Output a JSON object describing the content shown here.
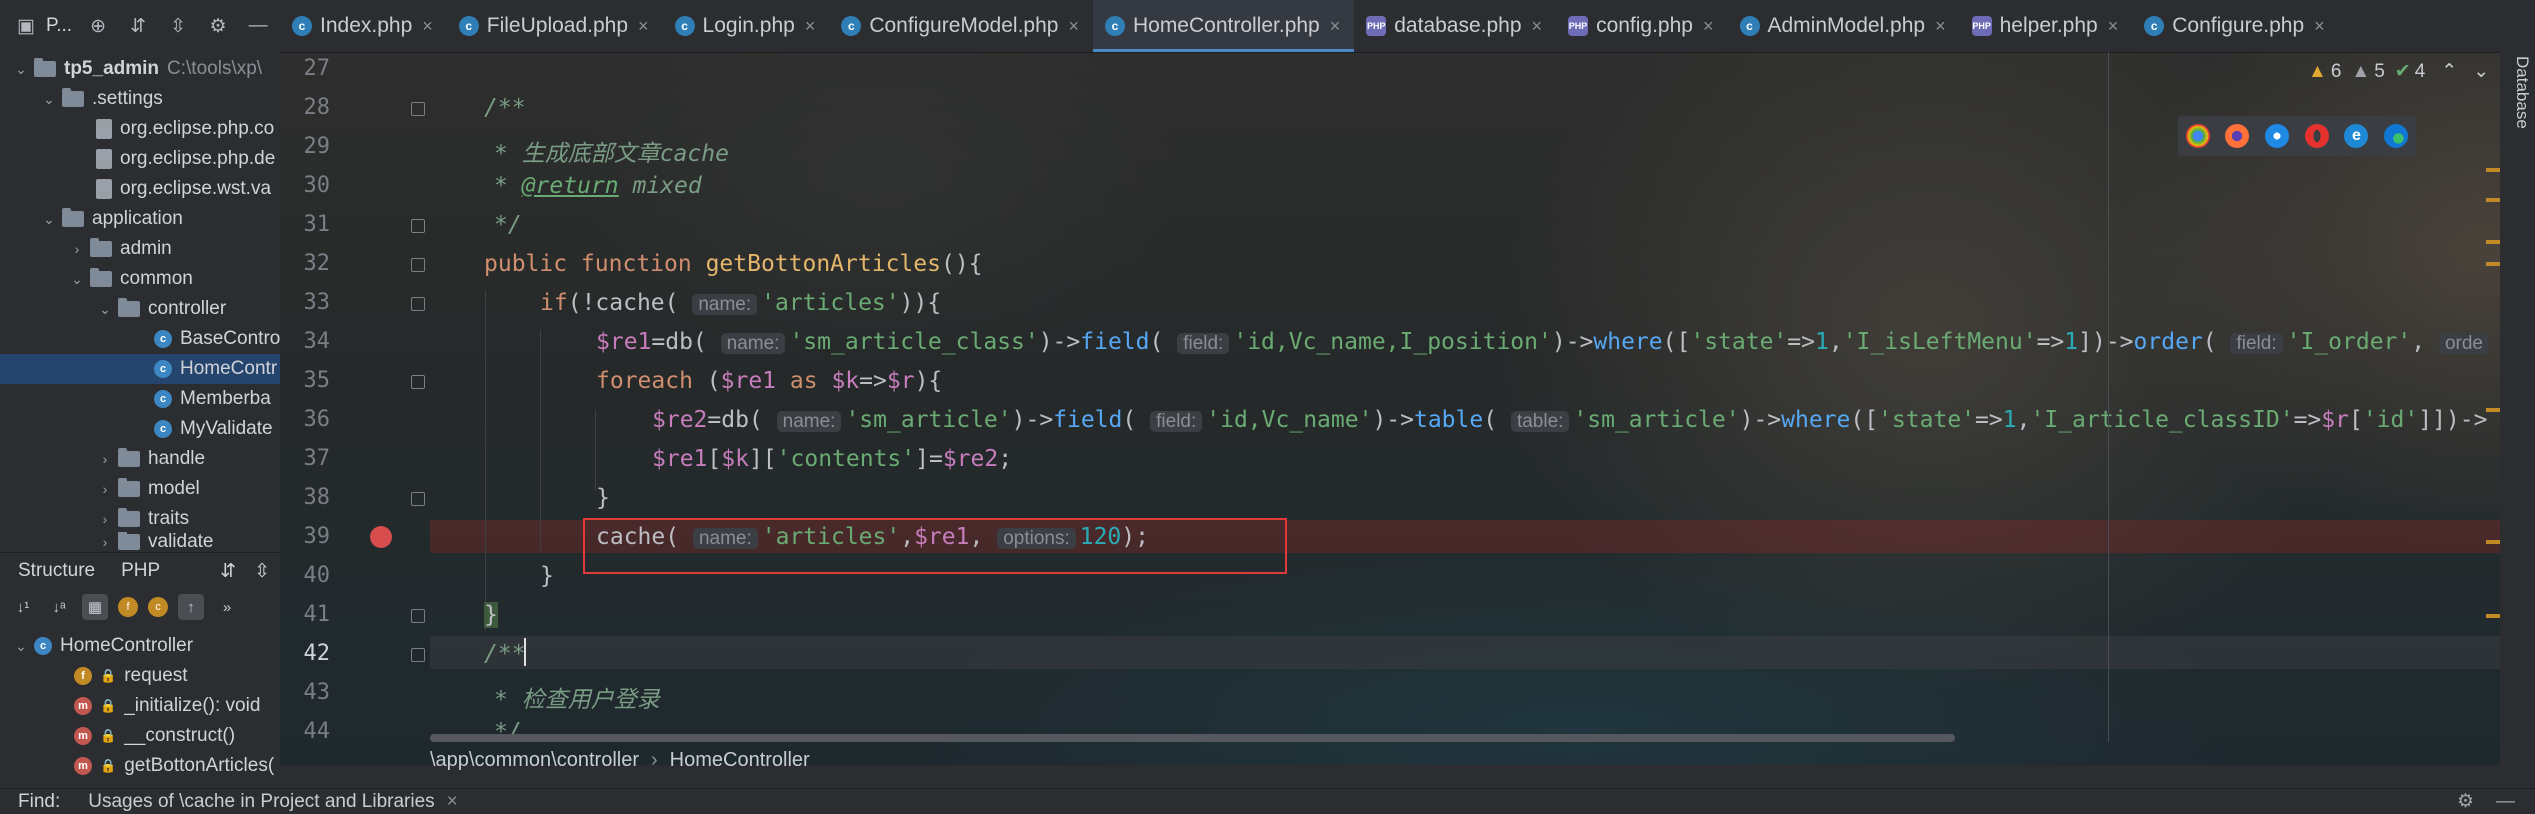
{
  "tabbar": {
    "project_label": "P...",
    "tabs": [
      {
        "label": "Index.php",
        "icon": "c"
      },
      {
        "label": "FileUpload.php",
        "icon": "c"
      },
      {
        "label": "Login.php",
        "icon": "c"
      },
      {
        "label": "ConfigureModel.php",
        "icon": "c"
      },
      {
        "label": "HomeController.php",
        "icon": "c",
        "active": true
      },
      {
        "label": "database.php",
        "icon": "php"
      },
      {
        "label": "config.php",
        "icon": "php"
      },
      {
        "label": "AdminModel.php",
        "icon": "c"
      },
      {
        "label": "helper.php",
        "icon": "php"
      },
      {
        "label": "Configure.php",
        "icon": "c"
      }
    ]
  },
  "project_tree": {
    "root": "tp5_admin",
    "root_path": "C:\\tools\\xp\\",
    "items": [
      ".settings",
      "org.eclipse.php.co",
      "org.eclipse.php.de",
      "org.eclipse.wst.va",
      "application",
      "admin",
      "common",
      "controller",
      "BaseContro",
      "HomeContr",
      "Memberba",
      "MyValidate",
      "handle",
      "model",
      "traits",
      "validate"
    ]
  },
  "structure": {
    "tab_structure": "Structure",
    "tab_php": "PHP",
    "root": "HomeController",
    "members": [
      "request",
      "_initialize(): void",
      "__construct()",
      "getBottonArticles("
    ]
  },
  "editor": {
    "line_numbers": [
      "27",
      "28",
      "29",
      "30",
      "31",
      "32",
      "33",
      "34",
      "35",
      "36",
      "37",
      "38",
      "39",
      "40",
      "41",
      "42",
      "43",
      "44"
    ],
    "comment_cache": "* 生成底部文章cache",
    "comment_return_tag": "@return",
    "comment_return_type": " mixed",
    "comment_login": "* 检查用户登录",
    "fn_name": "getBottonArticles",
    "hint_name": "name:",
    "hint_field": "field:",
    "hint_table": "table:",
    "hint_options": "options:",
    "str_articles": "'articles'",
    "str_class": "'sm_article_class'",
    "str_fields1": "'id,Vc_name,I_position'",
    "str_state": "'state'",
    "str_leftmenu": "'I_isLeftMenu'",
    "str_order": "'I_order'",
    "str_fields2": "'id,Vc_name'",
    "str_article": "'sm_article'",
    "str_classid": "'I_article_classID'",
    "str_id": "'id'",
    "str_contents": "'contents'",
    "num_one": "1",
    "num_ttl": "120",
    "trunc_order": "orde",
    "trunc_end": "->"
  },
  "inspection": {
    "warnings": "6",
    "weak": "5",
    "ok": "4"
  },
  "right_strip": {
    "label": "Database"
  },
  "breadcrumb": {
    "path": "\\app\\common\\controller",
    "class": "HomeController"
  },
  "findbar": {
    "label": "Find:",
    "query": "Usages of \\cache in Project and Libraries"
  }
}
